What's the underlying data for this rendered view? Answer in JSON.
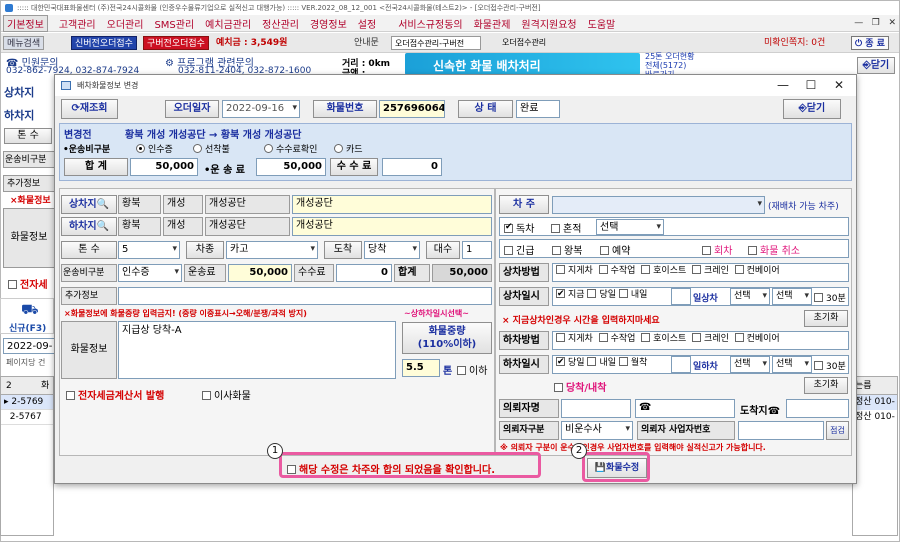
{
  "main_window": {
    "title": "::::: 대한민국대표화물센터 (주)전국24시콜화물 (인증우수물류기업으로 실적신고 대행가능) ::::: VER.2022_08_12_001 <전국24시콜화물(테스트2)> - [오더접수관리-구버전]",
    "menu": [
      "기본정보",
      "고객관리",
      "오더관리",
      "SMS관리",
      "예치금관리",
      "정산관리",
      "경영정보",
      "설정",
      "서비스규정동의",
      "화물관제",
      "원격지원요청",
      "도움말"
    ],
    "toolbar": {
      "menu_search": "메뉴검색",
      "new_order_btn": "신버전오더접수",
      "old_order_btn": "구버전오더접수",
      "deposit_label": "예치금 : 3,549원",
      "guide": "안내문",
      "tab1": "오더접수관리-구버전",
      "tab2": "오더접수관리",
      "unread": "미확인쪽지: 0건",
      "close_btn": "종 료"
    },
    "info": {
      "civil_label": "민원문의",
      "civil_phone": "032-862-7924, 032-874-7924",
      "program_label": "프로그램 관련문의",
      "program_phone": "032-811-2404, 032-872-1600",
      "distance": "거리 : 0km",
      "fare": "금액 :",
      "banner": "신속한 화물 배차처리",
      "status1": "25톤 오더현황",
      "status2": "전체(5172)",
      "status3": "바로가기",
      "close2": "닫기"
    },
    "left_panel": {
      "sangcha": "상차지",
      "hacha": "하차지",
      "tons": "톤 수",
      "transport": "운송비구분",
      "extra": "추가정보",
      "cargo_warn": "×화물정보",
      "cargo": "화물정보",
      "tax": "전자세",
      "truck_label": "신규(F3)",
      "date_partial": "2022-09-",
      "page_info": "페이지당 건"
    },
    "grid": {
      "col_num": "2",
      "col_a": "화",
      "col_b": "사",
      "rows": [
        "2-5769",
        "2-5767"
      ],
      "right_header": "는름",
      "right_rows": [
        [
          "정산",
          "010-"
        ],
        [
          "정산",
          "010-"
        ]
      ]
    }
  },
  "dialog": {
    "title": "배차화물정보 변경",
    "reload_btn": "재조회",
    "order_date_label": "오더일자",
    "order_date": "2022-09-16",
    "cargo_no_label": "화물번호",
    "cargo_no": "257696064",
    "status_label": "상 태",
    "status_value": "완료",
    "close_btn": "닫기",
    "before": {
      "label": "변경전",
      "route": "황북 개성 개성공단 → 황북 개성 개성공단",
      "transport_label": "•운송비구분",
      "transport_opts": [
        "인수증",
        "선착불",
        "수수료확인",
        "카드"
      ],
      "total_label": "합  계",
      "total": "50,000",
      "fare_label": "•운 송 료",
      "fare": "50,000",
      "fee_btn": "수 수 료",
      "fee": "0"
    },
    "form": {
      "sangcha_label": "상차지",
      "sangcha": [
        "황북",
        "개성",
        "개성공단",
        "개성공단"
      ],
      "hacha_label": "하차지",
      "hacha": [
        "황북",
        "개성",
        "개성공단",
        "개성공단"
      ],
      "tons_label": "톤 수",
      "tons": "5",
      "car_type_label": "차종",
      "car_type": "카고",
      "arrive_label": "도착",
      "arrive": "당착",
      "count_label": "대수",
      "count": "1",
      "transport_label": "운송비구분",
      "transport": "인수증",
      "fare_label": "운송료",
      "fare": "50,000",
      "fee_label": "수수료",
      "fee": "0",
      "total_label": "합계",
      "total": "50,000",
      "extra_label": "추가정보",
      "warn": "×화물정보에 화물중량 입력금지! (중량 이중표시→오해/분쟁/과적 방지)",
      "sel_link": "~상하차일시선택~",
      "cargo_label": "화물정보",
      "cargo_text": "지급상 당착-A",
      "weight_btn": "화물중량\n(110%이하)",
      "weight": "5.5",
      "ton_label": "톤",
      "below_label": "이하",
      "tax_label": "전자세금계산서 발행",
      "move_label": "이사화물"
    },
    "right": {
      "carowner_label": "차  주",
      "dispatch_hint": "(재배차 가능 차주)",
      "solo_label": "독차",
      "mixed_label": "혼적",
      "mixed_sel": "선택",
      "urgent": "긴급",
      "round": "왕복",
      "reserve": "예약",
      "returncar": "회차",
      "cancel": "화물 취소",
      "load_method_label": "상차방법",
      "methods": [
        "지게차",
        "수작업",
        "호이스트",
        "크레인",
        "컨베이어"
      ],
      "load_time_label": "상차일시",
      "time_opts": [
        "지금",
        "당일",
        "내일"
      ],
      "day_load": "일상차",
      "sel": "선택",
      "thirty": "30분",
      "load_warn": "× 지금상차인경우 시간을 입력하지마세요",
      "reset": "초기화",
      "unload_method_label": "하차방법",
      "unload_time_label": "하차일시",
      "unload_opts": [
        "당일",
        "내일",
        "월착"
      ],
      "day_unload": "일하차",
      "same_day": "당착/내착",
      "reset2": "초기화",
      "requester_label": "의뢰자명",
      "arrive_tel_label": "도착지☎",
      "req_type_label": "의뢰자구분",
      "req_type": "비운수사",
      "req_bizno_label": "의뢰자 사업자번호",
      "check": "점검",
      "req_note": "※ 의뢰자 구분이 운수사인경우 사업자번호를 입력해야 실적신고가 가능합니다."
    },
    "footer": {
      "confirm_text": "해당 수정은 차주와 합의 되었음을 확인합니다.",
      "modify_btn": "화물수정",
      "marker1": "1",
      "marker2": "2"
    }
  }
}
